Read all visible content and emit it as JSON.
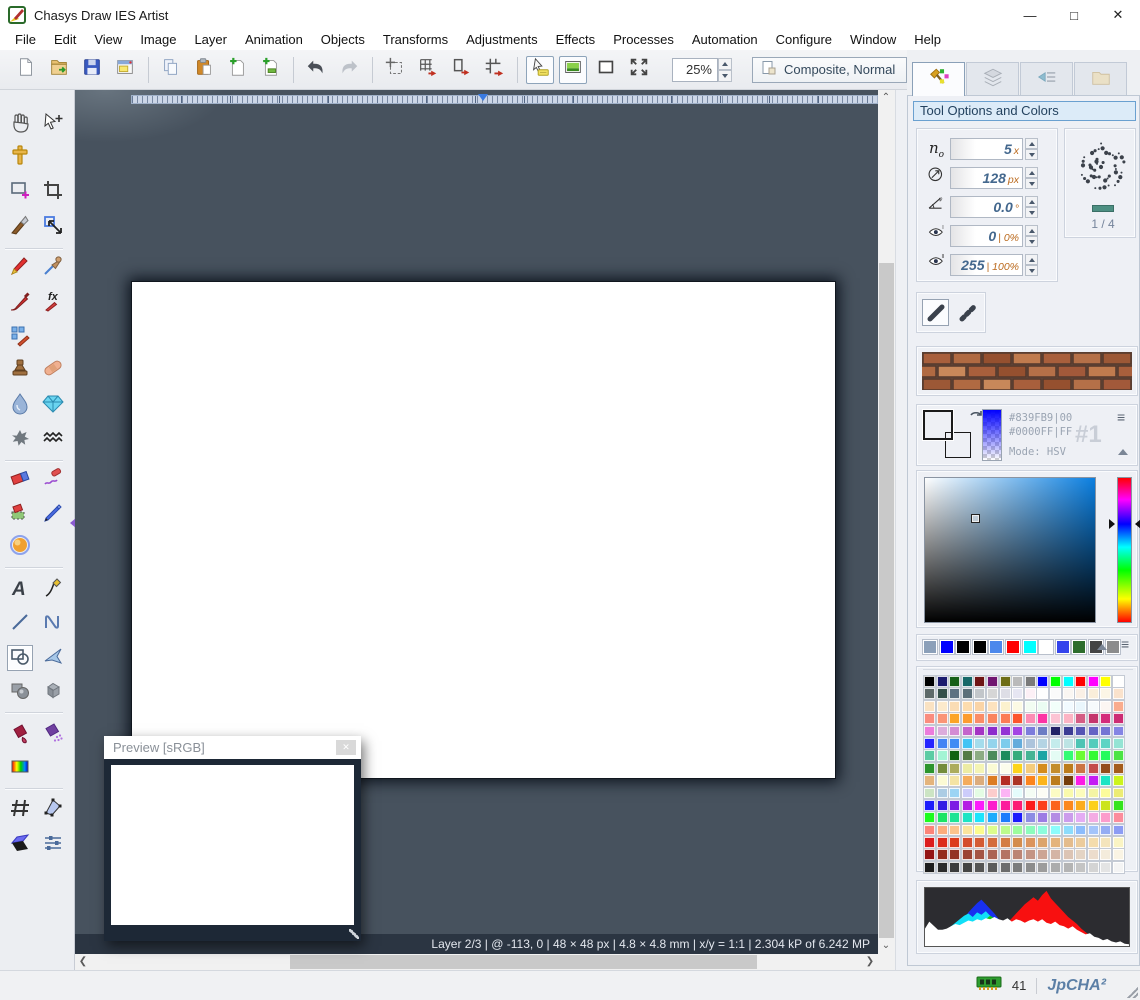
{
  "window": {
    "title": "Chasys Draw IES Artist",
    "minimize": "—",
    "maximize": "□",
    "close": "✕"
  },
  "menu": {
    "items": [
      "File",
      "Edit",
      "View",
      "Image",
      "Layer",
      "Animation",
      "Objects",
      "Transforms",
      "Adjustments",
      "Effects",
      "Processes",
      "Automation",
      "Configure",
      "Window",
      "Help"
    ]
  },
  "toolbar": {
    "zoom_value": "25%",
    "composite_label": "Composite, Normal",
    "groups": [
      [
        "new-document",
        "open",
        "save",
        "new-window"
      ],
      [
        "copy",
        "paste",
        "paste-as-image",
        "paste-as-layer"
      ],
      [
        "undo",
        "redo"
      ],
      [
        "resize-canvas",
        "resize-grid",
        "resize-object",
        "resize-all"
      ],
      [
        "pointer-info",
        "preview-toggle",
        "frame-toggle",
        "fullscreen"
      ]
    ],
    "pressed": [
      "pointer-info",
      "preview-toggle"
    ],
    "disabled": [
      "redo"
    ]
  },
  "tool_palette": {
    "selected": "shapes",
    "rows": [
      [
        "pan",
        "move"
      ],
      [
        "measure"
      ],
      [
        "select-rectangle",
        "crop"
      ],
      [
        "knife",
        "resize"
      ],
      [
        "pencil",
        "color-picker"
      ],
      [
        "brush",
        "fx-brush"
      ],
      [
        "pattern-brush"
      ],
      [
        "stamp",
        "heal"
      ],
      [
        "water-drop",
        "diamond"
      ],
      [
        "splatter",
        "waves"
      ],
      [
        "eraser",
        "eraser-pen"
      ],
      [
        "eraser-selection",
        "marker"
      ],
      [
        "sphere-3d"
      ],
      [
        "text",
        "calligraphy"
      ],
      [
        "line",
        "curve"
      ],
      [
        "shapes",
        "polygon"
      ],
      [
        "shapes-3d",
        "cube"
      ],
      [
        "fill",
        "spray-fill"
      ],
      [
        "gradient"
      ],
      [
        "mesh",
        "mesh-warp"
      ],
      [
        "shear",
        "adjust"
      ]
    ]
  },
  "canvas": {
    "status_text": "Layer 2/3 | @ -113, 0 | 48 × 48 px | 4.8 × 4.8 mm | x/y = 1:1 | 2.304 kP of 6.242 MP"
  },
  "preview_window": {
    "title": "Preview [sRGB]",
    "close": "✕"
  },
  "right_panel": {
    "tabs": [
      "tool-options",
      "layers",
      "objects",
      "resources"
    ],
    "title": "Tool Options and Colors",
    "fields": [
      {
        "label": "n",
        "sub": "o",
        "value": "5",
        "unit": "x"
      },
      {
        "icon": "diameter",
        "value": "128",
        "unit": "px"
      },
      {
        "icon": "angle",
        "value": "0.0",
        "unit": "°"
      },
      {
        "icon": "eye-min",
        "value": "0",
        "unit": "| 0%"
      },
      {
        "icon": "eye-max",
        "value": "255",
        "unit": "| 100%"
      }
    ],
    "brush_preview": {
      "page_indicator": "1 / 4"
    },
    "color": {
      "fg_hex": "#8CA0B9",
      "bg_hex": "#0000FF",
      "line1": "#839FB9|00",
      "line2": "#0000FF|FF",
      "mode": "Mode: HSV",
      "slot": "#1"
    },
    "recent_colors": [
      "#8CA0B9",
      "#0000FF",
      "#000000",
      "#000000",
      "#4C88EC",
      "#FF0000",
      "#00FFFF",
      "#FFFFFF",
      "#3444EC",
      "#2C6C2C",
      "#444444",
      "#8C8C8C"
    ],
    "palette": [
      [
        "#000000",
        "#1C1C6E",
        "#176017",
        "#176868",
        "#6E1414",
        "#701670",
        "#6E6E16",
        "#BABABA",
        "#7A7A7A",
        "#0000FF",
        "#00FF00",
        "#00FFFF",
        "#FF0000",
        "#FF00FF",
        "#FFFF00",
        "#FFFFFF"
      ],
      [
        "#5E6A6A",
        "#35504A",
        "#5E7282",
        "#5C707A",
        "#C2C6CA",
        "#D6D6D6",
        "#DEDEE6",
        "#E6E6F2",
        "#FCF0F6",
        "#FEFEFE",
        "#FAFAFA",
        "#FAF6F2",
        "#FAF0E6",
        "#FAEEDA",
        "#FCF6E6",
        "#FAE2CC"
      ],
      [
        "#FAE2C2",
        "#FCEACC",
        "#FADCB4",
        "#FCDCAE",
        "#FAD4A6",
        "#FCE2BE",
        "#FCF2CE",
        "#FCFAE4",
        "#F2FCF2",
        "#EAFCF2",
        "#F2FFFA",
        "#F2FAFF",
        "#EAF6FC",
        "#F6FAFC",
        "#FCF6F2",
        "#FAAC8E"
      ],
      [
        "#FA8C7E",
        "#FA9476",
        "#FCA426",
        "#FC9C2E",
        "#FA8C66",
        "#FA845E",
        "#FC7C56",
        "#FC542E",
        "#FC8CB4",
        "#FC34A4",
        "#FCC4D4",
        "#FCB4C4",
        "#D45C84",
        "#C4346C",
        "#D42C7C",
        "#CC2C74"
      ],
      [
        "#EC7CDC",
        "#DCACDC",
        "#D48CD4",
        "#C464CC",
        "#A434C4",
        "#8C2CCC",
        "#9434D4",
        "#A444E4",
        "#7C7CDC",
        "#6C7CC4",
        "#222266",
        "#3C3C94",
        "#5454B4",
        "#6464C4",
        "#7474D4",
        "#8484E4"
      ],
      [
        "#2424FF",
        "#4484F4",
        "#408CF4",
        "#44C4F4",
        "#A4DCEC",
        "#94D4EC",
        "#7CCCEC",
        "#64ACDC",
        "#ACC4DC",
        "#B4D4E4",
        "#C4ECEC",
        "#BCE4E4",
        "#4CC4B4",
        "#54CCBC",
        "#5CD4C4",
        "#94E4D4"
      ],
      [
        "#5CCCA4",
        "#A4F4D4",
        "#126412",
        "#547C44",
        "#8CAC84",
        "#4C8C5C",
        "#1C8C5C",
        "#34AC7C",
        "#44B494",
        "#1CA4A4",
        "#E4FCF4",
        "#34FC74",
        "#6CFC34",
        "#34FA34",
        "#24FC5C",
        "#4CE444"
      ],
      [
        "#2C942C",
        "#748C3C",
        "#ACAC5C",
        "#ECECA4",
        "#F4F4B4",
        "#FAFAD4",
        "#FCFCEC",
        "#FCD41C",
        "#F4CC7C",
        "#D48C1C",
        "#C48C2C",
        "#BC7C1C",
        "#CC7444",
        "#C44C4C",
        "#944C1C",
        "#A45C1C"
      ],
      [
        "#E4B47C",
        "#FCFAD4",
        "#F4E4A4",
        "#F4AC5C",
        "#DCAC7C",
        "#DC7C24",
        "#B42C24",
        "#AC3424",
        "#FC841C",
        "#FCB41C",
        "#BC7C1C",
        "#743C0C",
        "#FC1CE4",
        "#C41CF4",
        "#1CE4C4",
        "#CCF41C"
      ],
      [
        "#CCE4C4",
        "#ACCCE4",
        "#9CD4F4",
        "#CCCCFA",
        "#E4FCE4",
        "#FCCCCC",
        "#FCB4F4",
        "#E4FCFC",
        "#F4FCF4",
        "#FCFCF4",
        "#FCFCC4",
        "#FAFAAC",
        "#FCFCBC",
        "#F4F4A4",
        "#FCFC9C",
        "#ECEC74"
      ],
      [
        "#1C1CFC",
        "#341CE4",
        "#7C1CE4",
        "#B41CE4",
        "#FC1CFC",
        "#FC1CCC",
        "#FC1C9C",
        "#FC1C74",
        "#FC1C1C",
        "#FC401C",
        "#FC641C",
        "#FC881C",
        "#FCAC1C",
        "#FCD01C",
        "#CCE41C",
        "#34E41C"
      ],
      [
        "#1CFC1C",
        "#1CE464",
        "#1CE494",
        "#1CE4C4",
        "#1CE4FC",
        "#1CACFC",
        "#1C7CFC",
        "#1C1CFC",
        "#8C8CE4",
        "#9C7CE4",
        "#B48CE4",
        "#CC9CEC",
        "#E4ACF4",
        "#F4ACE4",
        "#FC9CCC",
        "#FC8C9C"
      ],
      [
        "#FC8478",
        "#FCAC7C",
        "#FCC48C",
        "#FAE49C",
        "#FCFC8C",
        "#DCFC8C",
        "#BCFC8C",
        "#9CFC9C",
        "#8CFCBC",
        "#8CFCDC",
        "#8CFCFC",
        "#8CDCFC",
        "#8CBCFC",
        "#A4C4FA",
        "#94ACF4",
        "#8C9CF4"
      ],
      [
        "#DC1C1C",
        "#DC2C1C",
        "#DC3C1C",
        "#D44C2C",
        "#D45C34",
        "#D46C3C",
        "#D47C44",
        "#D48C4C",
        "#DC945C",
        "#DCA46C",
        "#E4B47C",
        "#E4BC8C",
        "#ECCC9C",
        "#F4DCAC",
        "#F4E4BC",
        "#FAF4C4"
      ],
      [
        "#941414",
        "#942C1C",
        "#943424",
        "#9C4434",
        "#A45444",
        "#AC6454",
        "#B47464",
        "#BC8474",
        "#C49484",
        "#CCA494",
        "#D4B4A4",
        "#DCC4B4",
        "#E4D4C4",
        "#ECDCCC",
        "#F4ECDC",
        "#FAF4E4"
      ],
      [
        "#1C1C1C",
        "#2C2C2C",
        "#3C3C3C",
        "#444444",
        "#545454",
        "#5C5C5C",
        "#6C6C6C",
        "#7C7C7C",
        "#8C8C8C",
        "#9C9C9C",
        "#ACACAC",
        "#B4B4B4",
        "#C4C4C4",
        "#D4D4D4",
        "#E4E4E4",
        "#F4F4F4"
      ]
    ],
    "histogram": {
      "type": "area",
      "channels": [
        {
          "name": "blue",
          "color": "#1830f0",
          "values": [
            4,
            6,
            8,
            10,
            14,
            18,
            24,
            30,
            38,
            48,
            58,
            66,
            74,
            80,
            72,
            64,
            56,
            46,
            38,
            30,
            24,
            18,
            14,
            10,
            8,
            6,
            4,
            4,
            2,
            2,
            2,
            0,
            0,
            0,
            0,
            0,
            0,
            0,
            0,
            0,
            0,
            0,
            0,
            0,
            0,
            0,
            0,
            0
          ]
        },
        {
          "name": "cyan",
          "color": "#10e0f8",
          "values": [
            10,
            16,
            12,
            20,
            24,
            28,
            34,
            40,
            46,
            52,
            56,
            50,
            58,
            54,
            60,
            52,
            48,
            44,
            40,
            36,
            30,
            26,
            22,
            18,
            14,
            12,
            10,
            8,
            6,
            6,
            4,
            4,
            4,
            2,
            2,
            2,
            2,
            0,
            0,
            0,
            0,
            0,
            0,
            0,
            0,
            0,
            0,
            0
          ]
        },
        {
          "name": "green",
          "color": "#18c818",
          "values": [
            6,
            10,
            8,
            12,
            10,
            14,
            12,
            16,
            18,
            22,
            26,
            30,
            34,
            40,
            46,
            52,
            48,
            42,
            36,
            30,
            34,
            26,
            22,
            18,
            14,
            10,
            8,
            6,
            4,
            4,
            2,
            2,
            0,
            0,
            0,
            0,
            0,
            0,
            0,
            0,
            0,
            0,
            0,
            0,
            0,
            0,
            0,
            0
          ]
        },
        {
          "name": "red",
          "color": "#f81010",
          "values": [
            8,
            4,
            10,
            6,
            8,
            6,
            10,
            8,
            12,
            10,
            14,
            12,
            16,
            14,
            18,
            20,
            24,
            28,
            34,
            40,
            48,
            56,
            64,
            72,
            78,
            84,
            78,
            88,
            95,
            82,
            74,
            66,
            58,
            50,
            44,
            38,
            30,
            24,
            18,
            14,
            10,
            8,
            6,
            4,
            4,
            2,
            2,
            2
          ]
        },
        {
          "name": "white",
          "color": "#ffffff",
          "values": [
            30,
            42,
            35,
            28,
            28,
            30,
            34,
            38,
            36,
            40,
            44,
            42,
            46,
            44,
            48,
            46,
            50,
            46,
            44,
            48,
            42,
            46,
            44,
            40,
            44,
            46,
            42,
            46,
            40,
            38,
            42,
            36,
            34,
            30,
            34,
            28,
            24,
            20,
            22,
            16,
            14,
            10,
            12,
            8,
            6,
            8,
            4,
            3
          ]
        }
      ]
    }
  },
  "status_bar": {
    "memory_value": "41",
    "brand": "JpCHA²"
  }
}
